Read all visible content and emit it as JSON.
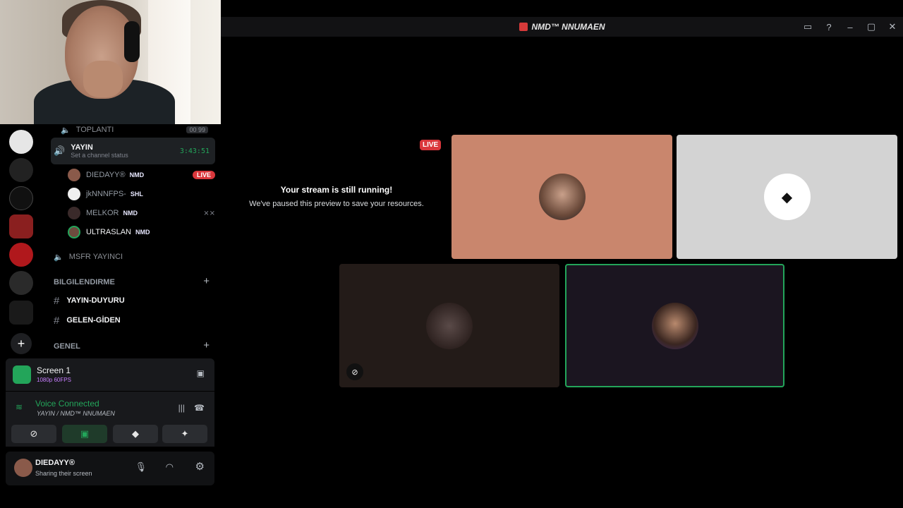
{
  "window": {
    "title": "NMD™ NNUMAEN"
  },
  "channels": {
    "toplanti": {
      "name": "TOPLANTI",
      "counter": "00 99"
    },
    "active": {
      "name": "YAYIN",
      "status": "Set a channel status",
      "timer": "3:43:51"
    },
    "users": [
      {
        "name": "DIEDAYY®",
        "tag": "NMD",
        "live": "LIVE"
      },
      {
        "name": "jkNNNFPS-",
        "tag": "SHL"
      },
      {
        "name": "MELKOR",
        "tag": "NMD"
      },
      {
        "name": "ULTRASLAN",
        "tag": "NMD"
      }
    ],
    "msfr": {
      "name": "MSFR YAYINCI"
    },
    "category1": {
      "name": "BILGILENDIRME"
    },
    "text_channels": [
      "YAYIN-DUYURU",
      "GELEN-GİDEN"
    ],
    "category2": {
      "name": "GENEL"
    }
  },
  "screen_share": {
    "title": "Screen 1",
    "quality": "1080p 60FPS"
  },
  "voice": {
    "status": "Voice Connected",
    "location": "YAYIN / NMD™ NNUMAEN"
  },
  "user": {
    "name": "DIEDAYY®",
    "status": "Sharing their screen"
  },
  "stream": {
    "live_label": "LIVE",
    "paused_title": "Your stream is still running!",
    "paused_subtitle": "We've paused this preview to save your resources."
  },
  "colors": {
    "accent_green": "#23a55a",
    "live_red": "#da373c",
    "tile1": "#c9866d",
    "tile2": "#d3d3d3",
    "tile3": "#231b18",
    "tile4": "#1b1520"
  }
}
